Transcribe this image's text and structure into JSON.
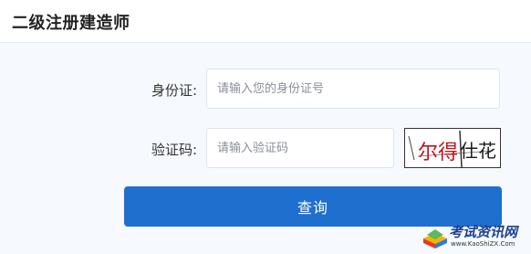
{
  "header": {
    "title": "二级注册建造师"
  },
  "form": {
    "id_label": "身份证:",
    "id_placeholder": "请输入您的身份证号",
    "captcha_label": "验证码:",
    "captcha_placeholder": "请输入验证码",
    "captcha_text": "尔得仕花",
    "submit_label": "查询"
  },
  "watermark": {
    "name": "考试资讯网",
    "url": "www.KaoShiZX.Com"
  },
  "colors": {
    "primary": "#1f6fce",
    "background": "#f6f9fd",
    "captcha_red": "#c0141c"
  }
}
